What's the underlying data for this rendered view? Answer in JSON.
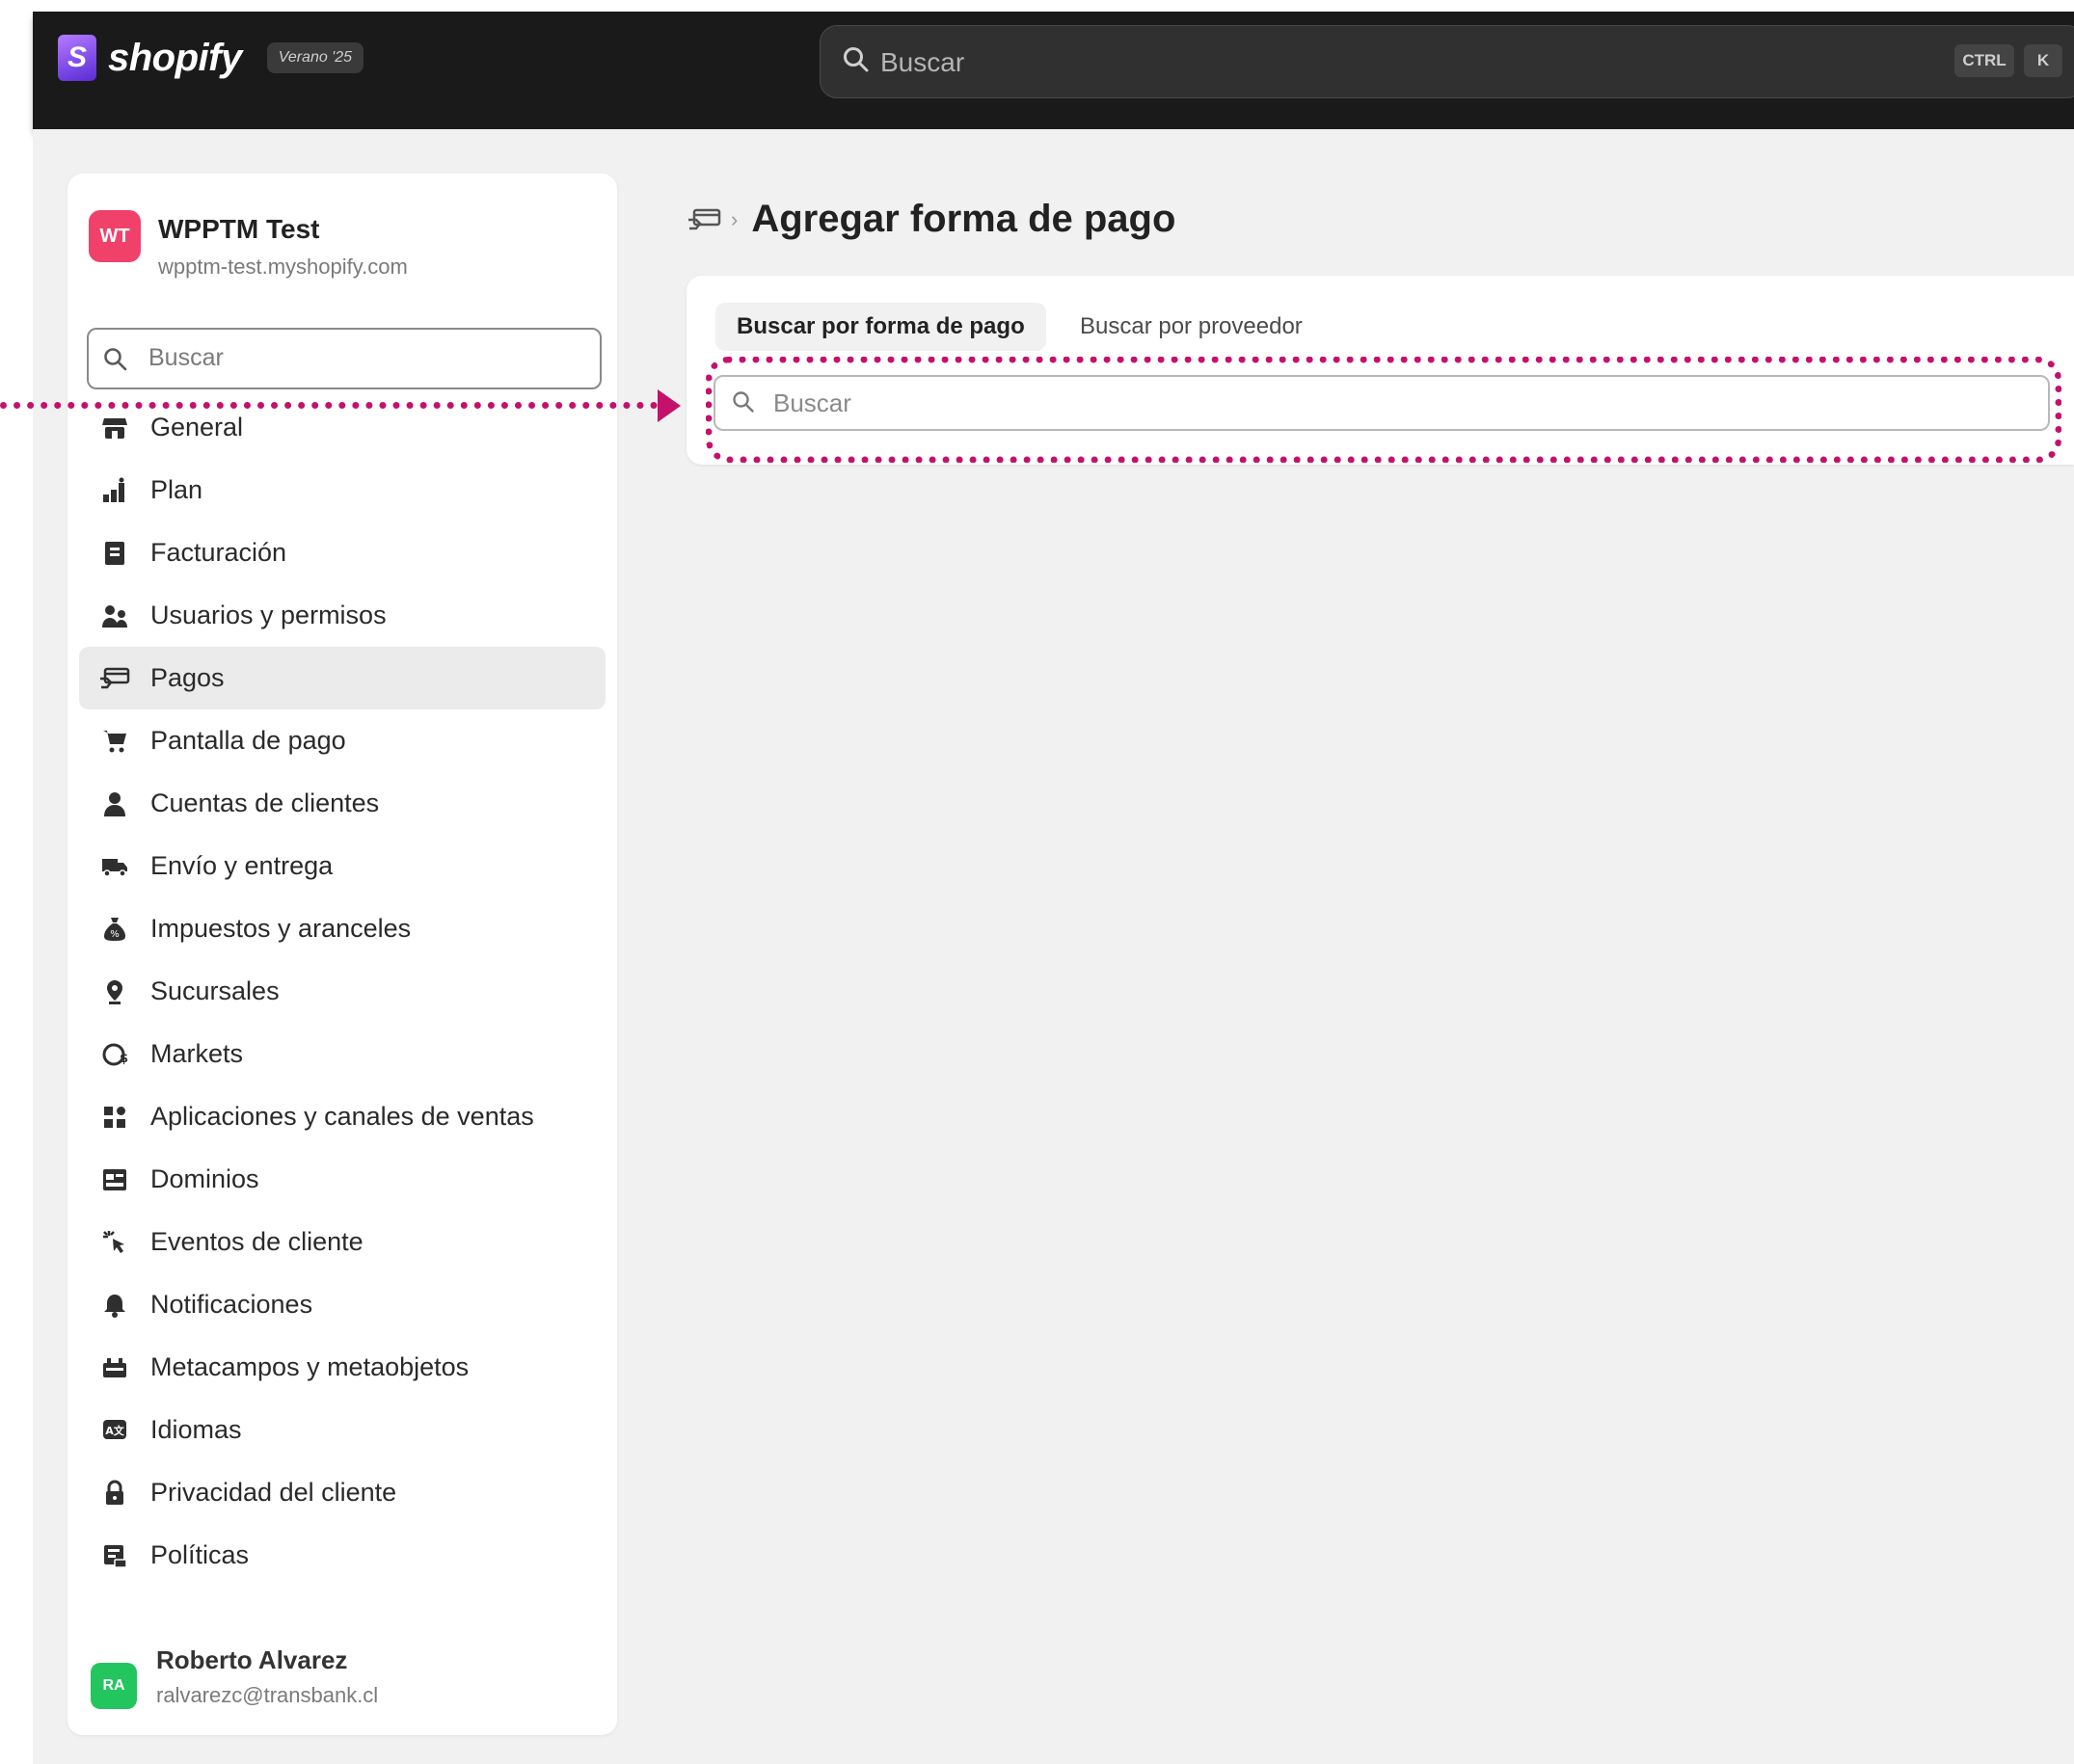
{
  "header": {
    "logo_text": "shopify",
    "season_badge": "Verano '25",
    "search_placeholder": "Buscar",
    "shortcut_ctrl": "CTRL",
    "shortcut_key": "K"
  },
  "sidebar": {
    "store": {
      "initials": "WT",
      "name": "WPPTM Test",
      "url": "wpptm-test.myshopify.com"
    },
    "search_placeholder": "Buscar",
    "items": [
      {
        "label": "General",
        "icon": "store-icon"
      },
      {
        "label": "Plan",
        "icon": "plan-icon"
      },
      {
        "label": "Facturación",
        "icon": "billing-icon"
      },
      {
        "label": "Usuarios y permisos",
        "icon": "users-icon"
      },
      {
        "label": "Pagos",
        "icon": "payments-icon",
        "active": true
      },
      {
        "label": "Pantalla de pago",
        "icon": "cart-icon"
      },
      {
        "label": "Cuentas de clientes",
        "icon": "customer-icon"
      },
      {
        "label": "Envío y entrega",
        "icon": "truck-icon"
      },
      {
        "label": "Impuestos y aranceles",
        "icon": "tax-icon"
      },
      {
        "label": "Sucursales",
        "icon": "location-icon"
      },
      {
        "label": "Markets",
        "icon": "globe-icon"
      },
      {
        "label": "Aplicaciones y canales de ventas",
        "icon": "apps-icon"
      },
      {
        "label": "Dominios",
        "icon": "domains-icon"
      },
      {
        "label": "Eventos de cliente",
        "icon": "events-icon"
      },
      {
        "label": "Notificaciones",
        "icon": "bell-icon"
      },
      {
        "label": "Metacampos y metaobjetos",
        "icon": "metafields-icon"
      },
      {
        "label": "Idiomas",
        "icon": "languages-icon"
      },
      {
        "label": "Privacidad del cliente",
        "icon": "lock-icon"
      },
      {
        "label": "Políticas",
        "icon": "policies-icon"
      }
    ],
    "user": {
      "initials": "RA",
      "name": "Roberto Alvarez",
      "email": "ralvarezc@transbank.cl"
    }
  },
  "main": {
    "title": "Agregar forma de pago",
    "tabs": [
      {
        "label": "Buscar por forma de pago",
        "selected": true
      },
      {
        "label": "Buscar por proveedor",
        "selected": false
      }
    ],
    "search_placeholder": "Buscar"
  },
  "annotation": {
    "color": "#c4116c"
  }
}
